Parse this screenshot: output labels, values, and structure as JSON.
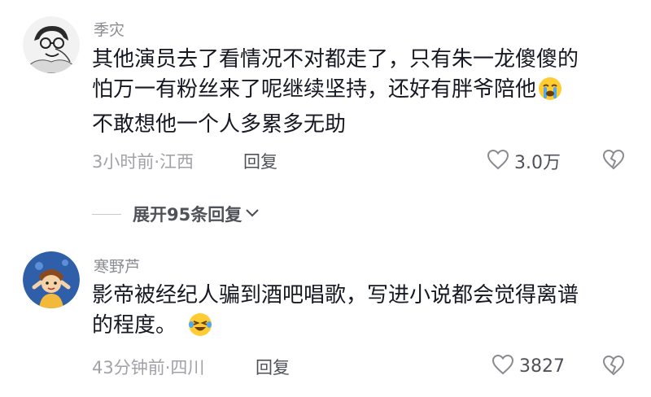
{
  "comments": [
    {
      "username": "季灾",
      "content_lines": [
        "其他演员去了看情况不对都走了，只有朱一龙傻傻的",
        "怕万一有粉丝来了呢继续坚持，还好有胖爷陪他",
        "不敢想他一个人多累多无助"
      ],
      "emoji": "crying-face",
      "meta": "3小时前·江西",
      "reply_label": "回复",
      "like_count": "3.0万"
    },
    {
      "username": "寒野芦",
      "content_lines": [
        "影帝被经纪人骗到酒吧唱歌，写进小说都会觉得离谱",
        "的程度。"
      ],
      "emoji": "laughing-crying-face",
      "meta": "43分钟前·四川",
      "reply_label": "回复",
      "like_count": "3827"
    }
  ],
  "expand_replies": "展开95条回复",
  "colors": {
    "text": "#161823",
    "secondary": "#8a8b91",
    "meta": "#a1a2a7",
    "action": "#505259"
  }
}
